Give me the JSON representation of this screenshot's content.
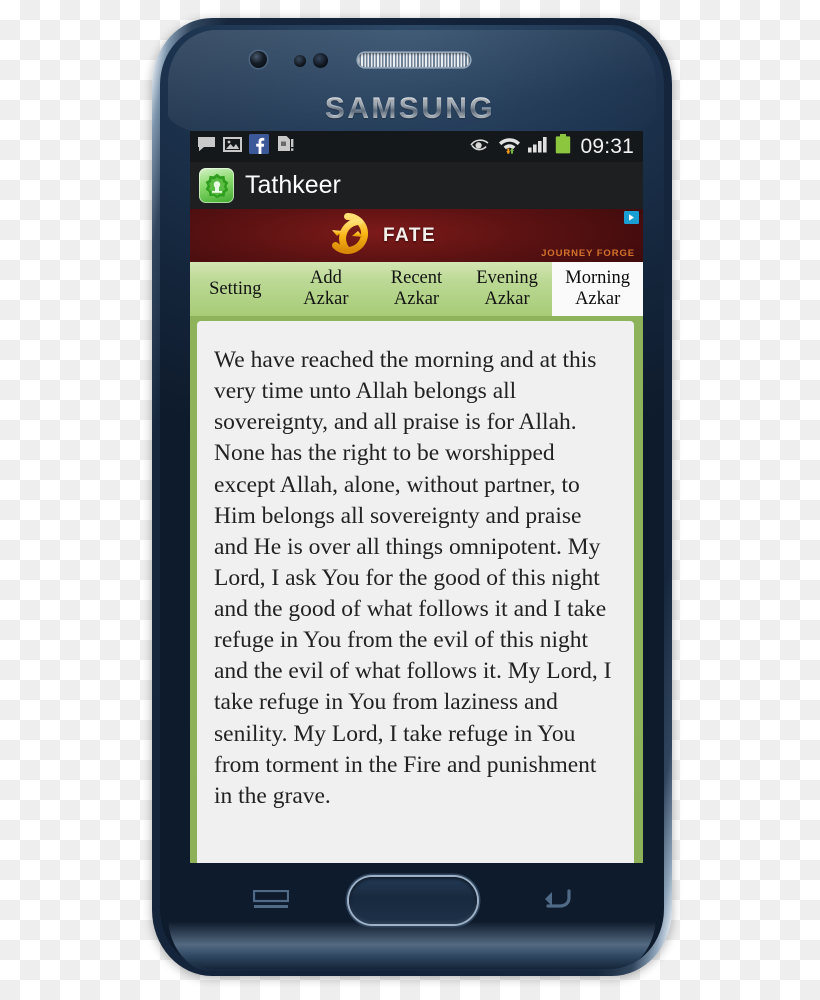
{
  "device": {
    "brand_logo": "SAMSUNG",
    "hardware": {
      "front_camera": "front-camera",
      "earpiece": "earpiece-speaker",
      "home_button": "home-button",
      "menu_key": "menu-key",
      "back_key": "back-key"
    }
  },
  "status_bar": {
    "left_icons": [
      {
        "name": "message-icon",
        "label": "Messages"
      },
      {
        "name": "gallery-icon",
        "label": "Gallery"
      },
      {
        "name": "facebook-icon",
        "label": "Facebook",
        "color": "#3B5998"
      },
      {
        "name": "sd-card-warning-icon",
        "label": "SD card"
      }
    ],
    "right_icons": [
      {
        "name": "smart-stay-eye-icon",
        "label": "Smart stay"
      },
      {
        "name": "wifi-icon",
        "label": "Wi-Fi"
      },
      {
        "name": "signal-bars-icon",
        "label": "Signal"
      },
      {
        "name": "battery-icon",
        "label": "Battery",
        "color": "#8CC63E"
      }
    ],
    "clock": "09:31"
  },
  "app_bar": {
    "icon_name": "tathkeer-app-icon",
    "title": "Tathkeer"
  },
  "ad": {
    "title": "FATE",
    "brand": "JOURNEY FORGE",
    "logo_name": "fate-ring-logo",
    "adchoices_label": "AdChoices",
    "background_color": "#5D1212",
    "accent_color": "#F7B423"
  },
  "tabs": [
    {
      "line1": "Setting",
      "line2": "",
      "active": false
    },
    {
      "line1": "Add",
      "line2": "Azkar",
      "active": false
    },
    {
      "line1": "Recent",
      "line2": "Azkar",
      "active": false
    },
    {
      "line1": "Evening",
      "line2": "Azkar",
      "active": false
    },
    {
      "line1": "Morning",
      "line2": "Azkar",
      "active": true
    }
  ],
  "content": {
    "azkar_text": "We have reached the morning and at this very time unto Allah belongs all sovereignty, and all praise is for Allah. None has the right to be worshipped except Allah, alone, without partner, to Him belongs all sovereignty and praise and He is over all things omnipotent. My Lord, I ask You for the good of this night and the good of what follows it and I take refuge in You from the evil of this night and the evil of what follows it. My Lord, I take refuge in You from laziness and senility. My Lord, I take refuge in You from torment in the Fire and punishment in the grave."
  },
  "theme": {
    "tab_bar_green": "#BCD995",
    "content_green": "#8CB159",
    "card_background": "#F0F0F0",
    "status_bar_background": "#15181A",
    "title_bar_background": "#1E1F21"
  }
}
